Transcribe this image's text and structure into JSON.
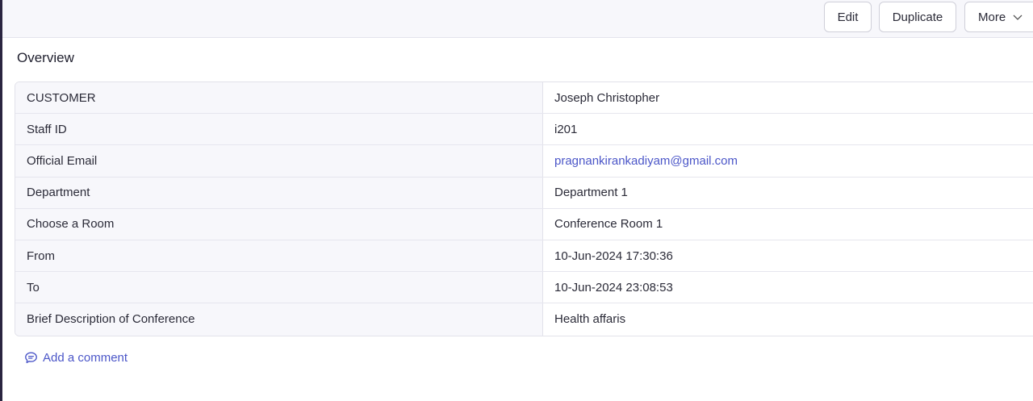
{
  "toolbar": {
    "edit_label": "Edit",
    "duplicate_label": "Duplicate",
    "more_label": "More"
  },
  "overview": {
    "title": "Overview",
    "rows": [
      {
        "label": "CUSTOMER",
        "value": "Joseph Christopher"
      },
      {
        "label": "Staff ID",
        "value": "i201"
      },
      {
        "label": "Official Email",
        "value": "pragnankirankadiyam@gmail.com"
      },
      {
        "label": "Department",
        "value": "Department 1"
      },
      {
        "label": "Choose a Room",
        "value": "Conference Room 1"
      },
      {
        "label": "From",
        "value": "10-Jun-2024 17:30:36"
      },
      {
        "label": "To",
        "value": "10-Jun-2024 23:08:53"
      },
      {
        "label": "Brief Description of Conference",
        "value": "Health affaris"
      }
    ]
  },
  "comment": {
    "label": "Add a comment",
    "icon": "comment-icon"
  },
  "colors": {
    "accent": "#4b56c8",
    "label_bg": "#f7f7fb",
    "border": "#e2e2ea"
  }
}
